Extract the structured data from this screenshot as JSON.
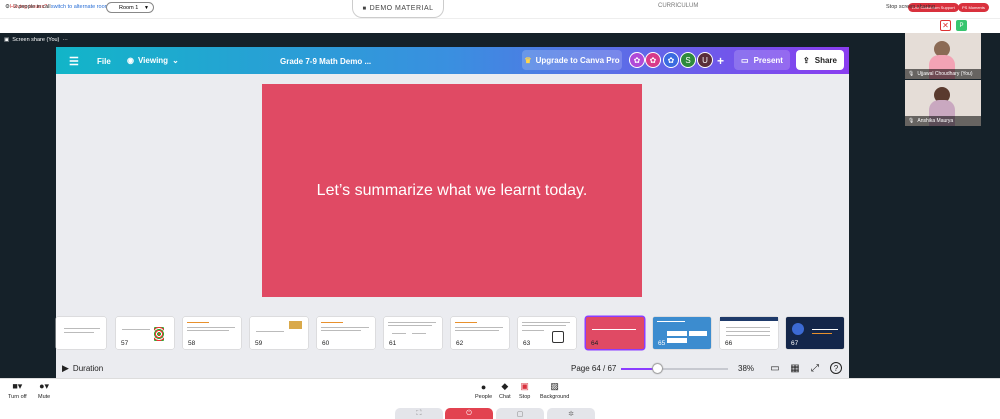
{
  "topbar": {
    "issues_text": "Having issues?",
    "issues_link": "switch to alternate room",
    "room": "Room 1",
    "demo_material": "DEMO MATERIAL",
    "curriculum": "CURRICULUM",
    "support_btn": "Live Classroom Support",
    "moments_btn": "PS Moments"
  },
  "infobar": {
    "people_count": "2 people in call",
    "stop_sharing": "Stop screen sharing",
    "stop_icon": "✕",
    "avatar_letter": "P"
  },
  "stage": {
    "share_label": "Screen share (You)",
    "share_more": "···"
  },
  "canva": {
    "file": "File",
    "viewing": "Viewing",
    "doc_title": "Grade 7-9 Math Demo ...",
    "upgrade": "Upgrade to Canva Pro",
    "avatars": [
      "S",
      "U"
    ],
    "add": "+",
    "present": "Present",
    "share": "Share",
    "slide_text": "Let’s summarize what we learnt today.",
    "thumbnails": [
      {
        "num": ""
      },
      {
        "num": "57"
      },
      {
        "num": "58"
      },
      {
        "num": "59"
      },
      {
        "num": "60"
      },
      {
        "num": "61"
      },
      {
        "num": "62"
      },
      {
        "num": "63"
      },
      {
        "num": "64"
      },
      {
        "num": "65"
      },
      {
        "num": "66"
      },
      {
        "num": "67"
      }
    ],
    "duration": "Duration",
    "page": "Page 64 / 67",
    "zoom": "38%",
    "zoom_fraction": 0.34,
    "help": "?"
  },
  "participants": [
    {
      "name": "Ujjawal Choudhary (You)"
    },
    {
      "name": "Anshika Maurya"
    }
  ],
  "controls": {
    "camera": "Turn off",
    "mic": "Mute",
    "people": "People",
    "chat": "Chat",
    "stop": "Stop",
    "background": "Background"
  },
  "colors": {
    "accent": "#8b3dff",
    "slide": "#e04a64",
    "stage": "#152129",
    "danger": "#d9313d"
  }
}
